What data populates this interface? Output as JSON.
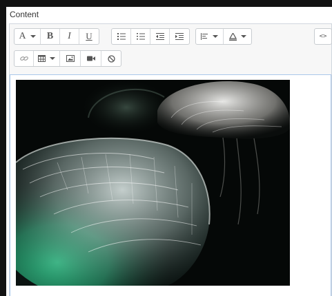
{
  "field": {
    "label": "Content"
  },
  "toolbar": {
    "font_glyph": "A",
    "bold_glyph": "B",
    "italic_glyph": "I",
    "underline_glyph": "U",
    "html_glyph": "<>"
  },
  "icons": {
    "font": "font-icon",
    "bold": "bold-icon",
    "italic": "italic-icon",
    "underline": "underline-icon",
    "unordered_list": "unordered-list-icon",
    "ordered_list": "ordered-list-icon",
    "outdent": "outdent-icon",
    "indent": "indent-icon",
    "align": "align-left-icon",
    "text_color": "text-color-icon",
    "html": "code-icon",
    "link": "link-icon",
    "table": "table-icon",
    "image": "image-icon",
    "video": "video-icon",
    "clear_format": "clear-format-icon"
  },
  "content": {
    "image_subject": "jellyfish"
  },
  "colors": {
    "page_bg": "#121212",
    "toolbar_bg": "#f7f7f7",
    "focus_border": "#a9c7ea",
    "icon": "#555555"
  }
}
